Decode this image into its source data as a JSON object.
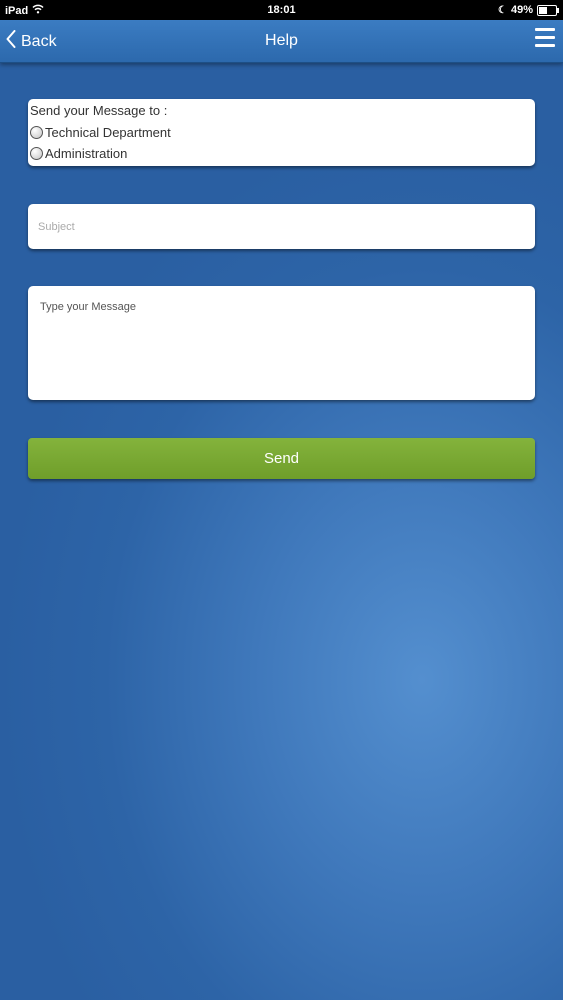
{
  "status_bar": {
    "device": "iPad",
    "time": "18:01",
    "battery_text": "49%",
    "battery_level": 0.49,
    "icons": [
      "wifi-icon",
      "moon-icon",
      "battery-icon"
    ]
  },
  "nav": {
    "back_label": "Back",
    "title": "Help",
    "menu_icon": "hamburger-menu-icon"
  },
  "recipient": {
    "label": "Send your Message to :",
    "options": [
      "Technical Department",
      "Administration"
    ]
  },
  "subject": {
    "placeholder": "Subject",
    "value": ""
  },
  "message": {
    "placeholder": "Type your Message",
    "value": ""
  },
  "send_label": "Send",
  "colors": {
    "background": "#3a73b6",
    "nav_bar": "#2f6fb3",
    "send_button": "#7aaa33",
    "card": "#ffffff"
  }
}
